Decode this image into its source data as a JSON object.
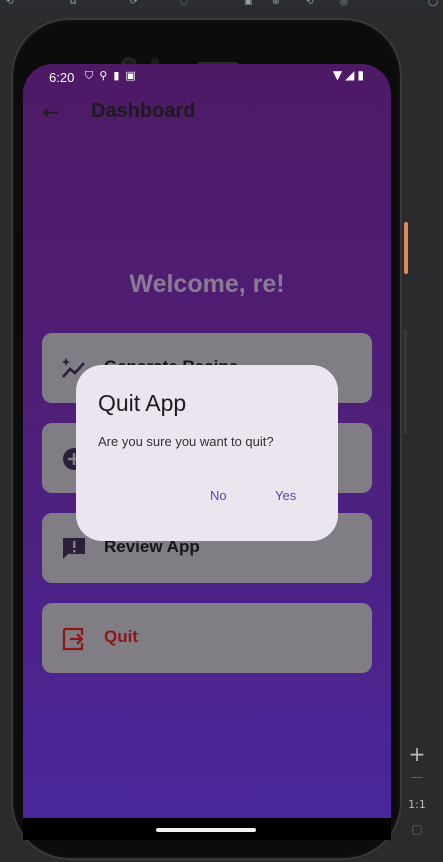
{
  "emulator": {
    "toolbar_glyphs": [
      "⟲",
      "⧉",
      "⟳",
      "◌",
      "▣",
      "⊕",
      "⟲",
      "◎",
      "◯"
    ],
    "zoom": {
      "plus": "+",
      "minus": "—",
      "ratio": "1:1",
      "fit": "▢"
    }
  },
  "status_bar": {
    "time": "6:20",
    "left_icons": [
      "shield-icon",
      "usb-icon",
      "sd-card-icon",
      "a-icon"
    ],
    "right_icons": [
      "wifi-icon",
      "signal-icon",
      "battery-icon"
    ]
  },
  "app_bar": {
    "title": "Dashboard",
    "back_icon": "arrow-back-icon"
  },
  "welcome_text": "Welcome, re!",
  "cards": [
    {
      "label": "Generate Recipe",
      "icon": "sparkle-chart-icon"
    },
    {
      "label": "",
      "icon": "add-circle-icon"
    },
    {
      "label": "Review App",
      "icon": "feedback-icon"
    },
    {
      "label": "Quit",
      "icon": "logout-icon"
    }
  ],
  "dialog": {
    "title": "Quit App",
    "message": "Are you sure you want to quit?",
    "no_label": "No",
    "yes_label": "Yes"
  },
  "colors": {
    "gradient_top": "#4e1a66",
    "gradient_bottom": "#49269a",
    "card": "#807d85",
    "dialog_bg": "#ebe5ef",
    "dialog_button": "#5b4aa5",
    "quit_red": "#8b1717"
  }
}
